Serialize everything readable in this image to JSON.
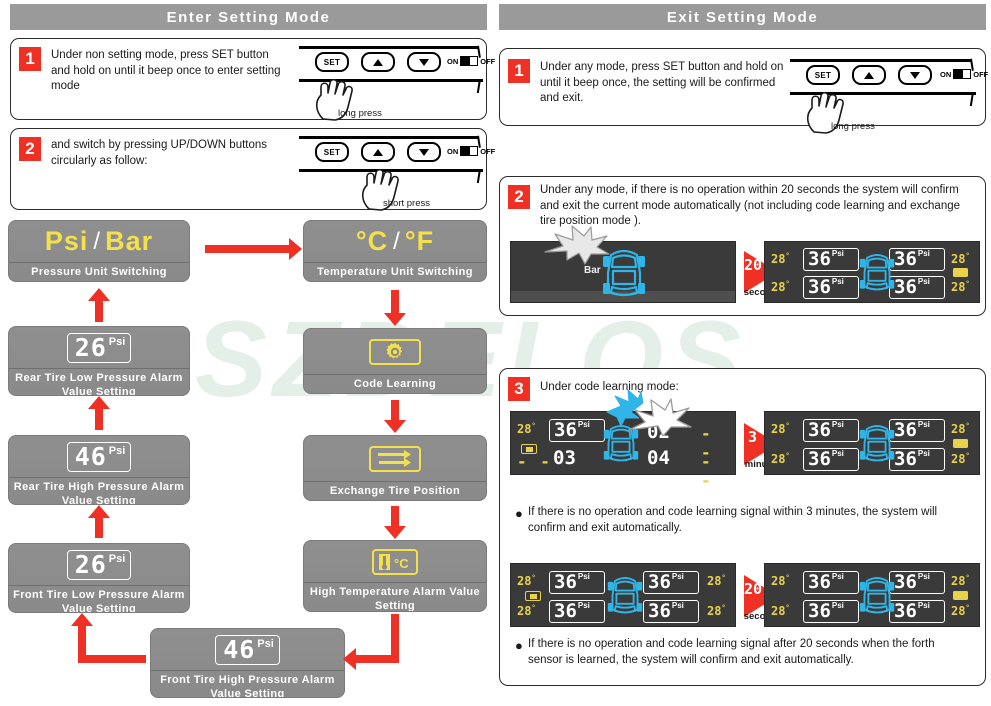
{
  "watermark": "SZDELOS",
  "panels": {
    "left": {
      "title": "Enter Setting Mode",
      "steps": [
        {
          "num": "1",
          "text": "Under non setting mode, press SET button and hold on until it beep once to enter setting mode",
          "press_label": "long press",
          "buttons": {
            "set": "SET",
            "on": "ON",
            "off": "OFF"
          }
        },
        {
          "num": "2",
          "text": "and switch by pressing UP/DOWN buttons circularly as follow:",
          "press_label": "short  press",
          "buttons": {
            "set": "SET",
            "on": "ON",
            "off": "OFF"
          }
        }
      ],
      "flow_nodes": [
        {
          "id": "pressure-unit",
          "display": "Psi / Bar",
          "value_a": "Psi",
          "separator": "/",
          "value_b": "Bar",
          "label": "Pressure Unit Switching",
          "icon": "text"
        },
        {
          "id": "temp-unit",
          "display": "°C / °F",
          "value_a": "°C",
          "separator": "/",
          "value_b": "°F",
          "label": "Temperature Unit Switching",
          "icon": "text"
        },
        {
          "id": "code-learning",
          "label": "Code Learning",
          "icon": "gear-icon"
        },
        {
          "id": "exchange-tire",
          "label": "Exchange Tire Position",
          "icon": "exchange-arrows-icon"
        },
        {
          "id": "high-temp-alarm",
          "label": "High Temperature Alarm Value Setting",
          "icon": "thermometer-celsius-icon"
        },
        {
          "id": "front-high",
          "value": "46",
          "unit": "Psi",
          "label": "Front Tire High Pressure Alarm Value Setting",
          "icon": "lcd"
        },
        {
          "id": "front-low",
          "value": "26",
          "unit": "Psi",
          "label": "Front Tire Low Pressure Alarm Value Setting",
          "icon": "lcd"
        },
        {
          "id": "rear-high",
          "value": "46",
          "unit": "Psi",
          "label": "Rear Tire High Pressure Alarm Value Setting",
          "icon": "lcd"
        },
        {
          "id": "rear-low",
          "value": "26",
          "unit": "Psi",
          "label": "Rear Tire Low Pressure Alarm Value Setting",
          "icon": "lcd"
        }
      ]
    },
    "right": {
      "title": "Exit Setting Mode",
      "steps": [
        {
          "num": "1",
          "text": "Under any mode, press SET button and hold on until it beep once, the setting will be confirmed and exit.",
          "press_label": "long press",
          "buttons": {
            "set": "SET",
            "on": "ON",
            "off": "OFF"
          }
        },
        {
          "num": "2",
          "text": "Under any mode, if there is no operation within 20 seconds the system will confirm and exit the current mode automatically (not including code learning and exchange tire position  mode )."
        },
        {
          "num": "3",
          "text": "Under code learning mode:"
        }
      ],
      "bullets": [
        "If there is no operation and code learning signal within 3 minutes, the system will confirm and exit automatically.",
        "If there is no operation and code learning signal after 20 seconds when the forth sensor is learned, the system will confirm and exit automatically."
      ],
      "timers": [
        {
          "id": "timer-step2",
          "value": "20",
          "unit": "seconds"
        },
        {
          "id": "timer-step3a",
          "value": "3",
          "unit": "minutes"
        },
        {
          "id": "timer-step3b",
          "value": "20",
          "unit": "seconds"
        }
      ],
      "displays": {
        "step2_before": {
          "id": "lcd-step2-before",
          "mode": "bar-alert",
          "bar_label": "Bar"
        },
        "step2_after": {
          "id": "lcd-step2-after",
          "temps": {
            "fl": "28",
            "fr": "28",
            "rl": "28",
            "rr": "28"
          },
          "unit_deg": "°",
          "pressures": {
            "fl": "36",
            "fr": "36",
            "rl": "36",
            "rr": "36"
          },
          "psi_unit": "Psi",
          "battery": "full"
        },
        "step3_learning": {
          "id": "lcd-step3-learning",
          "temp_fl": "28",
          "unit_deg": "°",
          "pressure_fl": "36",
          "psi_unit": "Psi",
          "codes": {
            "fr": "02",
            "rl": "03",
            "rr": "04"
          },
          "dashes": "- -",
          "battery": "learning"
        },
        "step3_after": {
          "id": "lcd-step3-after",
          "temps": {
            "fl": "28",
            "fr": "28",
            "rl": "28",
            "rr": "28"
          },
          "unit_deg": "°",
          "pressures": {
            "fl": "36",
            "fr": "36",
            "rl": "36",
            "rr": "36"
          },
          "psi_unit": "Psi",
          "battery": "full"
        },
        "step3b_before": {
          "id": "lcd-step3b-before",
          "temps": {
            "fl": "28",
            "fr": "28",
            "rl": "28",
            "rr": "28"
          },
          "unit_deg": "°",
          "pressures": {
            "fl": "36",
            "fr": "36",
            "rl": "36",
            "rr": "36"
          },
          "psi_unit": "Psi",
          "battery": "learning"
        },
        "step3b_after": {
          "id": "lcd-step3b-after",
          "temps": {
            "fl": "28",
            "fr": "28",
            "rl": "28",
            "rr": "28"
          },
          "unit_deg": "°",
          "pressures": {
            "fl": "36",
            "fr": "36",
            "rl": "36",
            "rr": "36"
          },
          "psi_unit": "Psi",
          "battery": "full"
        }
      }
    }
  },
  "colors": {
    "accent_red": "#ee3124",
    "node_gray": "#8f8f8f",
    "lcd_yellow": "#e8d24a",
    "lcd_blue": "#2fb5e8",
    "title_gray": "#9a9a9a"
  }
}
